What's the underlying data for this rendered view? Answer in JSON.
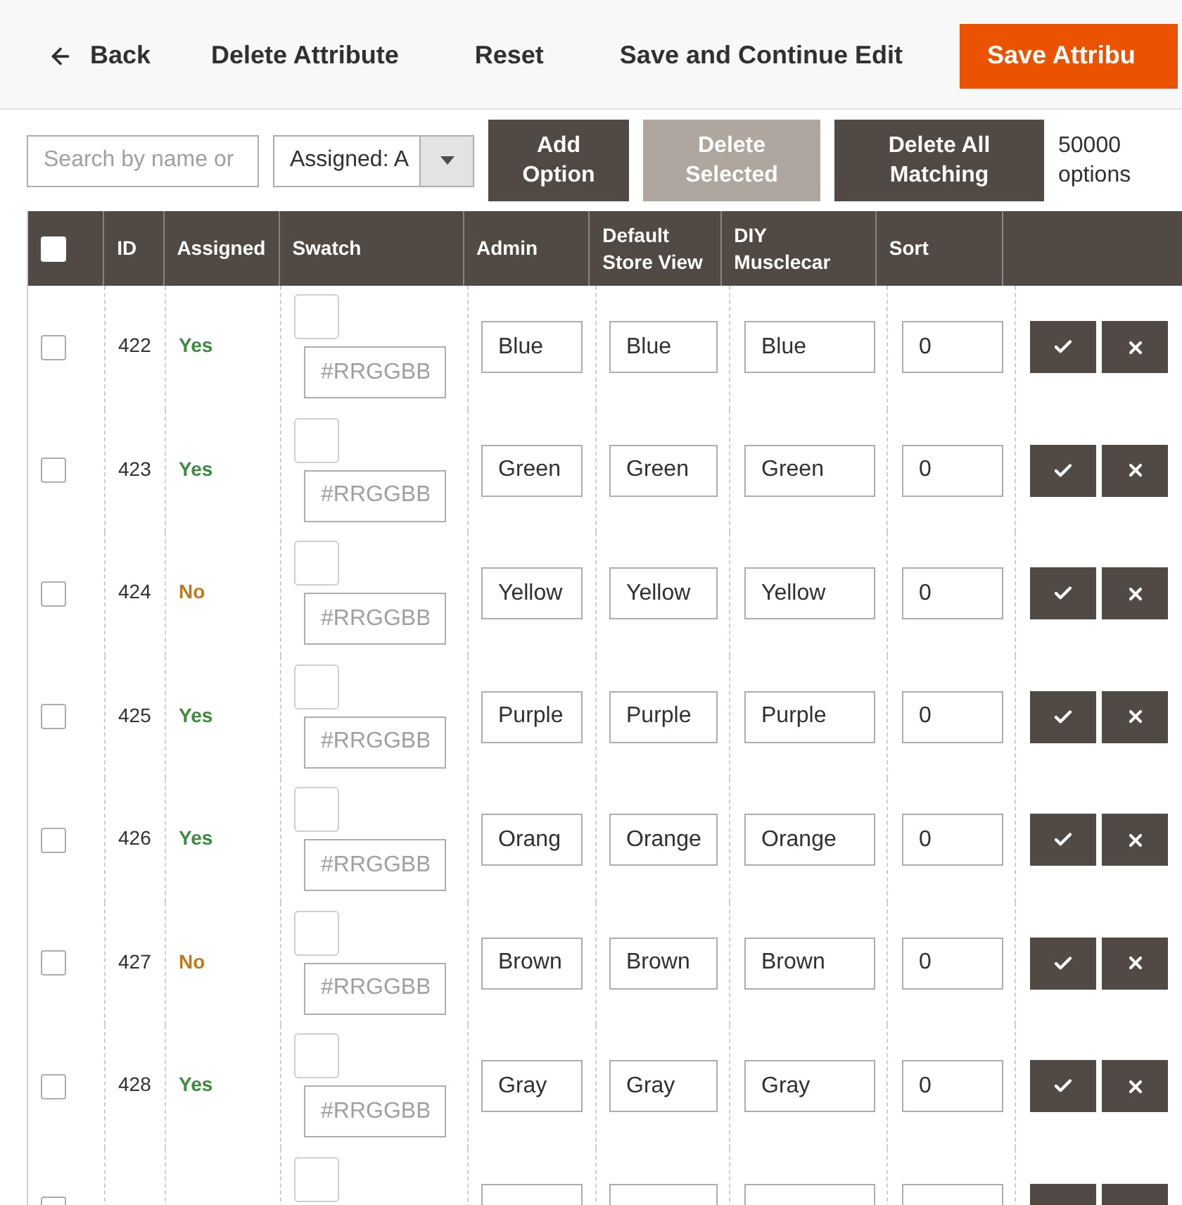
{
  "page_actions": [
    {
      "kind": "back",
      "label": "Back"
    },
    {
      "kind": "plain",
      "label": "Delete Attribute"
    },
    {
      "kind": "plain",
      "label": "Reset"
    },
    {
      "kind": "plain",
      "label": "Save and Continue Edit"
    },
    {
      "kind": "primary",
      "label": "Save Attribu"
    }
  ],
  "toolbar": {
    "search": {
      "placeholder": "Search by name or"
    },
    "filter": {
      "value": "Assigned: A"
    },
    "buttons": [
      {
        "label": "Add Option",
        "disabled": false
      },
      {
        "label": "Delete Selected",
        "disabled": true
      },
      {
        "label": "Delete All Matching",
        "disabled": false
      }
    ],
    "count": "50000 options"
  },
  "table": {
    "select_all": {
      "checked": false
    },
    "columns": [
      "ID",
      "Assigned",
      "Swatch",
      "Admin",
      "Default Store View",
      "DIY Musclecar",
      "Sort"
    ],
    "rows": [
      {
        "checked": false,
        "id": "422",
        "assigned": "Yes",
        "assigned_ok": true,
        "swatch_placeholder": "#RRGGBB",
        "admin": "Blue",
        "default_store_view": "Blue",
        "diy_musclecar": "Blue",
        "sort": "0"
      },
      {
        "checked": false,
        "id": "423",
        "assigned": "Yes",
        "assigned_ok": true,
        "swatch_placeholder": "#RRGGBB",
        "admin": "Green",
        "default_store_view": "Green",
        "diy_musclecar": "Green",
        "sort": "0"
      },
      {
        "checked": false,
        "id": "424",
        "assigned": "No",
        "assigned_ok": false,
        "swatch_placeholder": "#RRGGBB",
        "admin": "Yellow",
        "default_store_view": "Yellow",
        "diy_musclecar": "Yellow",
        "sort": "0"
      },
      {
        "checked": false,
        "id": "425",
        "assigned": "Yes",
        "assigned_ok": true,
        "swatch_placeholder": "#RRGGBB",
        "admin": "Purple",
        "default_store_view": "Purple",
        "diy_musclecar": "Purple",
        "sort": "0"
      },
      {
        "checked": false,
        "id": "426",
        "assigned": "Yes",
        "assigned_ok": true,
        "swatch_placeholder": "#RRGGBB",
        "admin": "Orang",
        "default_store_view": "Orange",
        "diy_musclecar": "Orange",
        "sort": "0"
      },
      {
        "checked": false,
        "id": "427",
        "assigned": "No",
        "assigned_ok": false,
        "swatch_placeholder": "#RRGGBB",
        "admin": "Brown",
        "default_store_view": "Brown",
        "diy_musclecar": "Brown",
        "sort": "0"
      },
      {
        "checked": false,
        "id": "428",
        "assigned": "Yes",
        "assigned_ok": true,
        "swatch_placeholder": "#RRGGBB",
        "admin": "Gray",
        "default_store_view": "Gray",
        "diy_musclecar": "Gray",
        "sort": "0"
      },
      {
        "checked": false
      }
    ]
  }
}
